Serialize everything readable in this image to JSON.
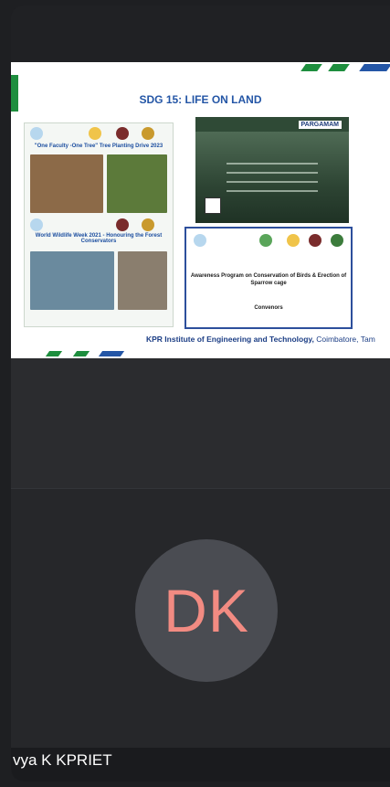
{
  "slide": {
    "title": "SDG 15: LIFE ON LAND",
    "left_panel_caption_top": "\"One Faculty -One Tree\" Tree Planting Drive 2023",
    "left_panel_caption_mid": "World Wildlife Week 2021 - Honouring the Forest Conservators",
    "right_top_logo": "PARGAMAM",
    "right_bottom_title": "Awareness Program on Conservation of Birds & Erection of Sparrow cage",
    "right_bottom_sub": "Convenors",
    "footer_bold": "KPR Institute of Engineering and Technology,",
    "footer_rest": " Coimbatore, Tam",
    "colors": {
      "title": "#2456a6",
      "green": "#1e8e3e",
      "blue": "#1c3e85"
    }
  },
  "participant": {
    "initials": "DK",
    "name": "vya K KPRIET",
    "avatar_text_color": "#f28b82"
  }
}
